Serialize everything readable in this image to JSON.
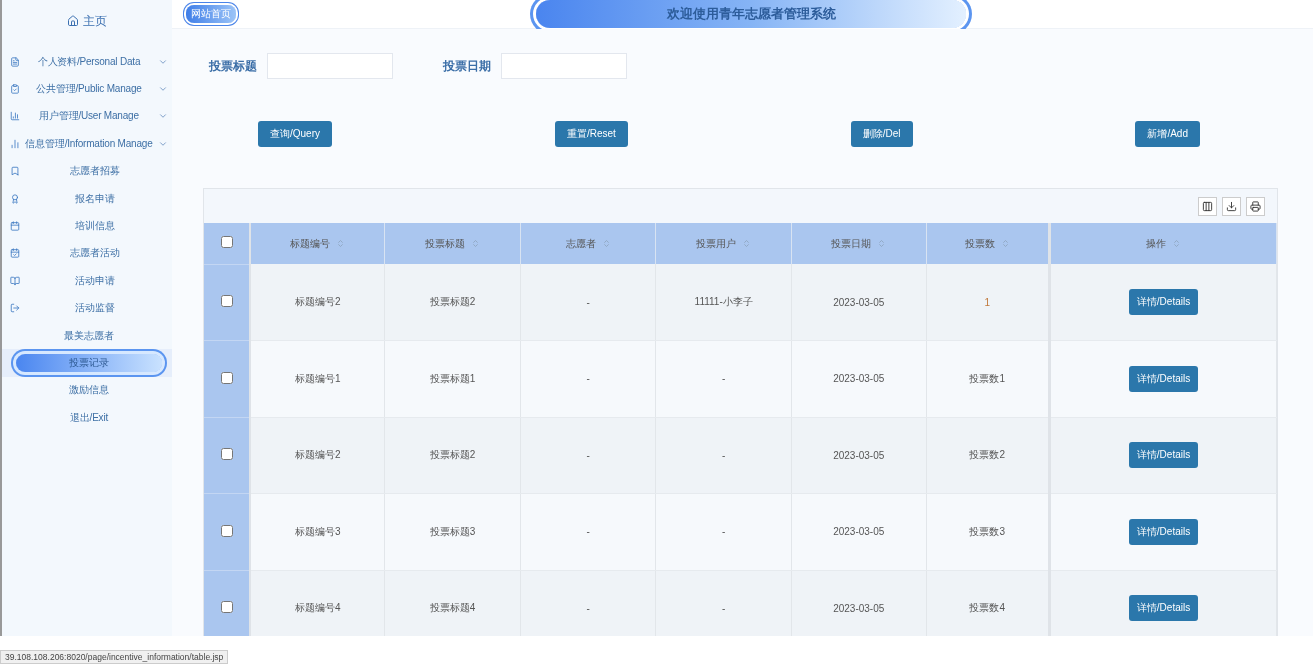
{
  "sidebar": {
    "home": "主页",
    "items": [
      {
        "kind": "group",
        "label": "个人资料/Personal Data",
        "selected": false
      },
      {
        "kind": "group",
        "label": "公共管理/Public Manage",
        "selected": false
      },
      {
        "kind": "group",
        "label": "用户管理/User Manage",
        "selected": false
      },
      {
        "kind": "group",
        "label": "信息管理/Information Manage",
        "selected": false
      },
      {
        "kind": "link",
        "label": "志愿者招募",
        "selected": false
      },
      {
        "kind": "link",
        "label": "报名申请",
        "selected": false
      },
      {
        "kind": "link",
        "label": "培训信息",
        "selected": false
      },
      {
        "kind": "link",
        "label": "志愿者活动",
        "selected": false
      },
      {
        "kind": "link",
        "label": "活动申请",
        "selected": false
      },
      {
        "kind": "link",
        "label": "活动监督",
        "selected": false
      },
      {
        "kind": "plain",
        "label": "最美志愿者",
        "selected": false
      },
      {
        "kind": "plain",
        "label": "投票记录",
        "selected": true
      },
      {
        "kind": "plain",
        "label": "激励信息",
        "selected": false
      },
      {
        "kind": "plain",
        "label": "退出/Exit",
        "selected": false
      }
    ]
  },
  "header": {
    "site_link": "网站首页",
    "title": "欢迎使用青年志愿者管理系统"
  },
  "search": [
    {
      "label": "投票标题"
    },
    {
      "label": "投票日期"
    }
  ],
  "actions": [
    "查询/Query",
    "重置/Reset",
    "删除/Del",
    "新增/Add"
  ],
  "table": {
    "all_checked": false,
    "columns": [
      "标题编号",
      "投票标题",
      "志愿者",
      "投票用户",
      "投票日期",
      "投票数",
      "操作"
    ],
    "rows": [
      {
        "checked": false,
        "cells": [
          "标题编号2",
          "投票标题2",
          "-",
          "11111-小李子",
          "2023-03-05",
          "1"
        ],
        "action": "详情/Details"
      },
      {
        "checked": false,
        "cells": [
          "标题编号1",
          "投票标题1",
          "-",
          "-",
          "2023-03-05",
          "投票数1"
        ],
        "action": "详情/Details"
      },
      {
        "checked": false,
        "cells": [
          "标题编号2",
          "投票标题2",
          "-",
          "-",
          "2023-03-05",
          "投票数2"
        ],
        "action": "详情/Details"
      },
      {
        "checked": false,
        "cells": [
          "标题编号3",
          "投票标题3",
          "-",
          "-",
          "2023-03-05",
          "投票数3"
        ],
        "action": "详情/Details"
      },
      {
        "checked": false,
        "cells": [
          "标题编号4",
          "投票标题4",
          "-",
          "-",
          "2023-03-05",
          "投票数4"
        ],
        "action": "详情/Details"
      }
    ]
  },
  "status_url": "39.108.108.206:8020/page/incentive_information/table.jsp"
}
